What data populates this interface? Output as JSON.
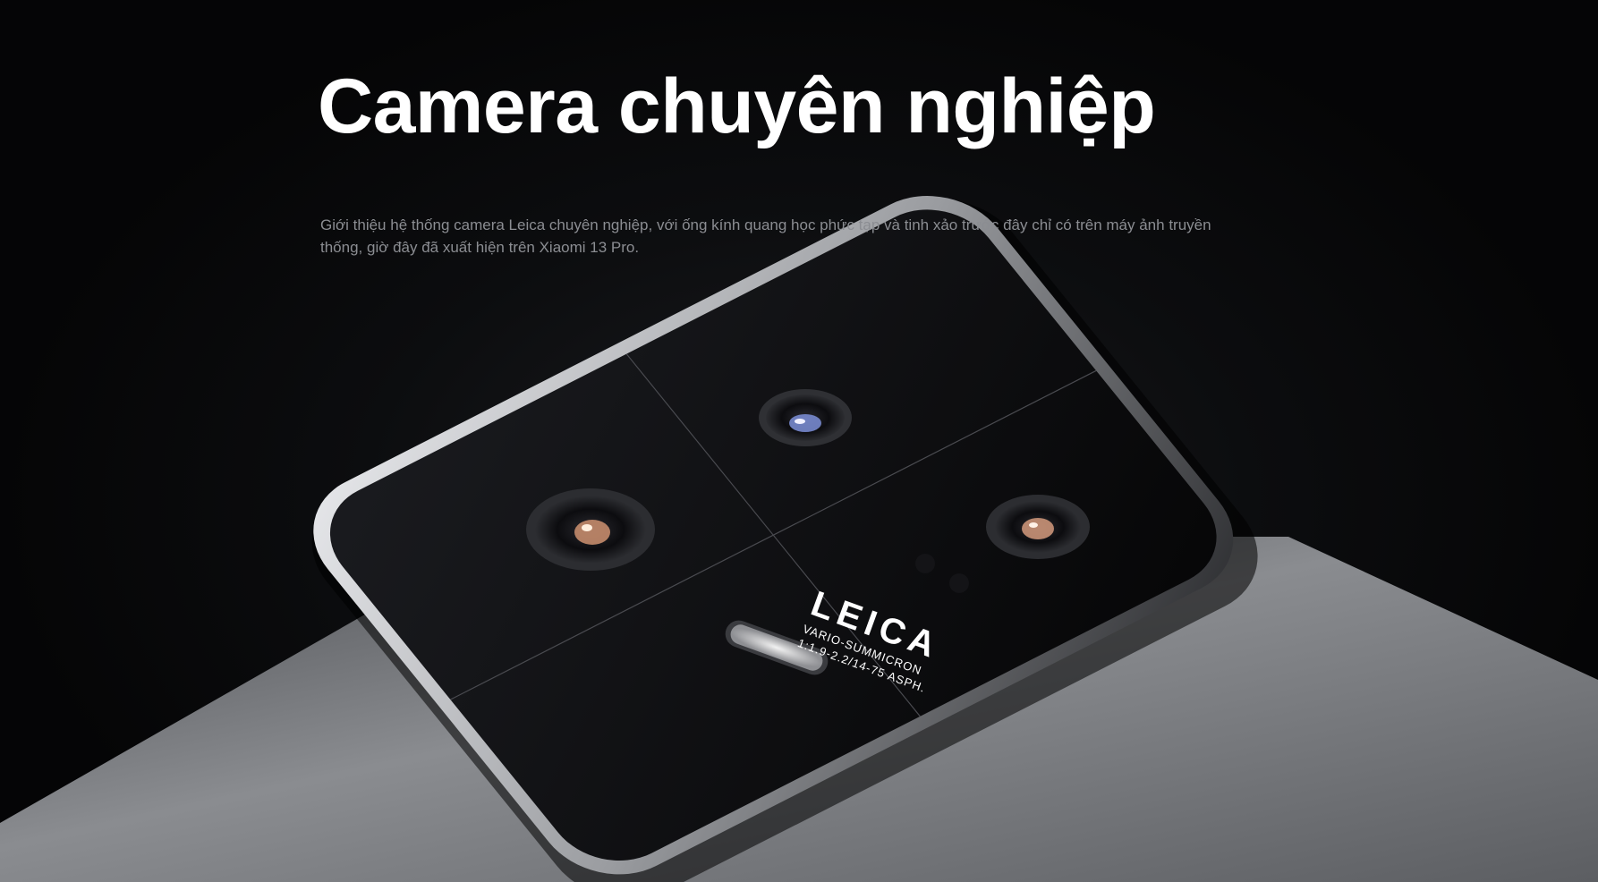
{
  "hero": {
    "headline": "Camera chuyên nghiệp",
    "description": "Giới thiệu hệ thống camera Leica chuyên nghiệp, với ống kính quang học phức tạp và tinh xảo trước đây chỉ có trên máy ảnh truyền thống, giờ đây đã xuất hiện trên Xiaomi 13 Pro."
  },
  "product_image": {
    "brand_mark": "LEICA",
    "lens_line_1": "VARIO-SUMMICRON",
    "lens_line_2": "1:1.9-2.2/14-75 ASPH."
  },
  "colors": {
    "background": "#0c0d0f",
    "headline": "#ffffff",
    "description": "#8b8d92",
    "phone_body": "#7a7c80",
    "camera_module": "#0b0b0d"
  }
}
